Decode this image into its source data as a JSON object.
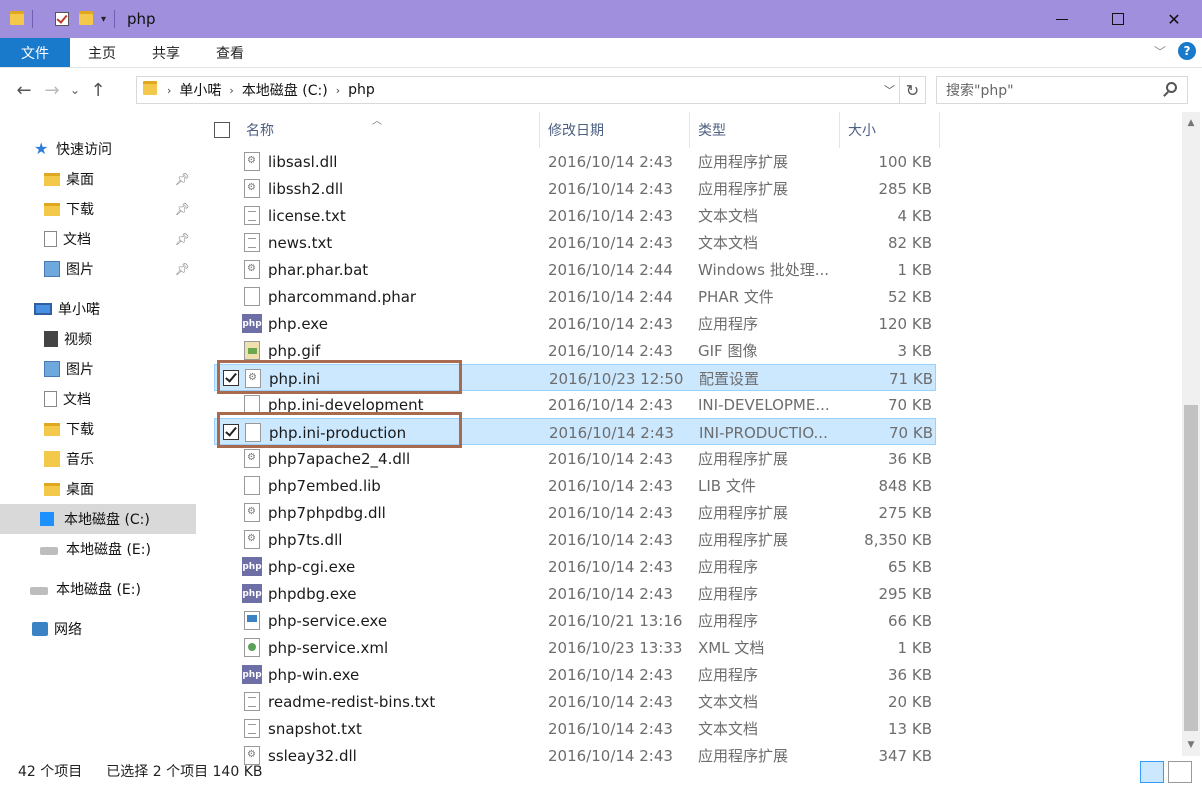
{
  "window": {
    "title": "php"
  },
  "ribbon": {
    "tabs": [
      "文件",
      "主页",
      "共享",
      "查看"
    ]
  },
  "address": {
    "crumbs": [
      "单小喏",
      "本地磁盘 (C:)",
      "php"
    ],
    "search_placeholder": "搜索\"php\""
  },
  "columns": {
    "name": "名称",
    "date": "修改日期",
    "type": "类型",
    "size": "大小"
  },
  "sidebar": {
    "quick_access": "快速访问",
    "quick_items": [
      "桌面",
      "下载",
      "文档",
      "图片"
    ],
    "pc": "单小喏",
    "pc_items": [
      "视频",
      "图片",
      "文档",
      "下载",
      "音乐",
      "桌面",
      "本地磁盘 (C:)",
      "本地磁盘 (E:)"
    ],
    "drive_e": "本地磁盘 (E:)",
    "network": "网络"
  },
  "files": [
    {
      "name": "libsasl.dll",
      "date": "2016/10/14 2:43",
      "type": "应用程序扩展",
      "size": "100 KB",
      "icon": "dll"
    },
    {
      "name": "libssh2.dll",
      "date": "2016/10/14 2:43",
      "type": "应用程序扩展",
      "size": "285 KB",
      "icon": "dll"
    },
    {
      "name": "license.txt",
      "date": "2016/10/14 2:43",
      "type": "文本文档",
      "size": "4 KB",
      "icon": "txt"
    },
    {
      "name": "news.txt",
      "date": "2016/10/14 2:43",
      "type": "文本文档",
      "size": "82 KB",
      "icon": "txt"
    },
    {
      "name": "phar.phar.bat",
      "date": "2016/10/14 2:44",
      "type": "Windows 批处理...",
      "size": "1 KB",
      "icon": "dll"
    },
    {
      "name": "pharcommand.phar",
      "date": "2016/10/14 2:44",
      "type": "PHAR 文件",
      "size": "52 KB",
      "icon": "doc"
    },
    {
      "name": "php.exe",
      "date": "2016/10/14 2:43",
      "type": "应用程序",
      "size": "120 KB",
      "icon": "php"
    },
    {
      "name": "php.gif",
      "date": "2016/10/14 2:43",
      "type": "GIF 图像",
      "size": "3 KB",
      "icon": "gif"
    },
    {
      "name": "php.ini",
      "date": "2016/10/23 12:50",
      "type": "配置设置",
      "size": "71 KB",
      "icon": "dll",
      "selected": true
    },
    {
      "name": "php.ini-development",
      "date": "2016/10/14 2:43",
      "type": "INI-DEVELOPME...",
      "size": "70 KB",
      "icon": "doc"
    },
    {
      "name": "php.ini-production",
      "date": "2016/10/14 2:43",
      "type": "INI-PRODUCTIO...",
      "size": "70 KB",
      "icon": "doc",
      "selected": true
    },
    {
      "name": "php7apache2_4.dll",
      "date": "2016/10/14 2:43",
      "type": "应用程序扩展",
      "size": "36 KB",
      "icon": "dll"
    },
    {
      "name": "php7embed.lib",
      "date": "2016/10/14 2:43",
      "type": "LIB 文件",
      "size": "848 KB",
      "icon": "doc"
    },
    {
      "name": "php7phpdbg.dll",
      "date": "2016/10/14 2:43",
      "type": "应用程序扩展",
      "size": "275 KB",
      "icon": "dll"
    },
    {
      "name": "php7ts.dll",
      "date": "2016/10/14 2:43",
      "type": "应用程序扩展",
      "size": "8,350 KB",
      "icon": "dll"
    },
    {
      "name": "php-cgi.exe",
      "date": "2016/10/14 2:43",
      "type": "应用程序",
      "size": "65 KB",
      "icon": "php"
    },
    {
      "name": "phpdbg.exe",
      "date": "2016/10/14 2:43",
      "type": "应用程序",
      "size": "295 KB",
      "icon": "php"
    },
    {
      "name": "php-service.exe",
      "date": "2016/10/21 13:16",
      "type": "应用程序",
      "size": "66 KB",
      "icon": "exe"
    },
    {
      "name": "php-service.xml",
      "date": "2016/10/23 13:33",
      "type": "XML 文档",
      "size": "1 KB",
      "icon": "xml"
    },
    {
      "name": "php-win.exe",
      "date": "2016/10/14 2:43",
      "type": "应用程序",
      "size": "36 KB",
      "icon": "php"
    },
    {
      "name": "readme-redist-bins.txt",
      "date": "2016/10/14 2:43",
      "type": "文本文档",
      "size": "20 KB",
      "icon": "txt"
    },
    {
      "name": "snapshot.txt",
      "date": "2016/10/14 2:43",
      "type": "文本文档",
      "size": "13 KB",
      "icon": "txt"
    },
    {
      "name": "ssleay32.dll",
      "date": "2016/10/14 2:43",
      "type": "应用程序扩展",
      "size": "347 KB",
      "icon": "dll"
    }
  ],
  "status": {
    "count": "42 个项目",
    "selection": "已选择 2 个项目  140 KB"
  },
  "colors": {
    "title_bar": "#a08fdc",
    "file_tab": "#1979ca",
    "selection": "#cce8ff",
    "highlight_box": "#a86b4f"
  }
}
